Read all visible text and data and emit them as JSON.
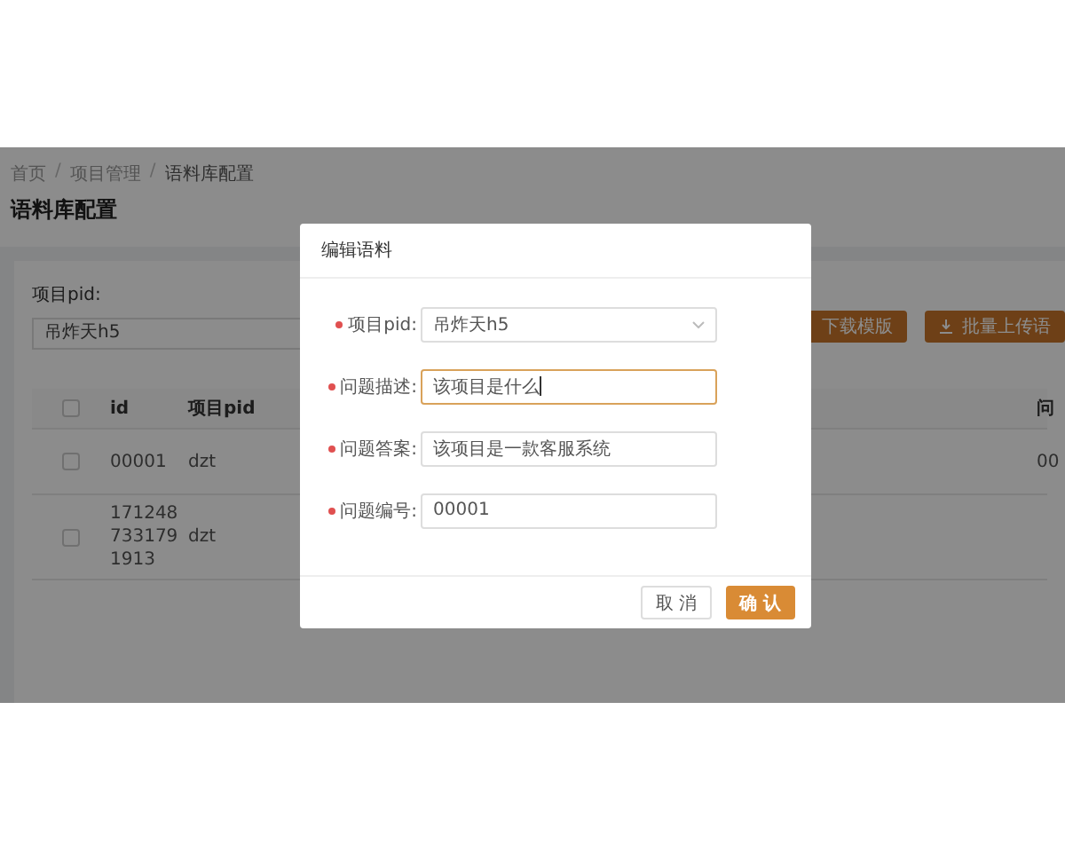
{
  "breadcrumb": {
    "separator": "/",
    "items": [
      "首页",
      "项目管理",
      "语料库配置"
    ]
  },
  "page_title": "语料库配置",
  "filter": {
    "label": "项目pid:",
    "value": "吊炸天h5"
  },
  "actions": [
    {
      "label": "下载模版"
    },
    {
      "label": "批量上传语",
      "icon": true
    }
  ],
  "table": {
    "header_checked": false,
    "columns": [
      "id",
      "项目pid",
      "问"
    ],
    "rows": [
      {
        "checked": false,
        "cells": [
          "00001",
          "dzt",
          "00"
        ]
      },
      {
        "checked": false,
        "cells": [
          "1712487331791913",
          "dzt"
        ]
      }
    ]
  },
  "dialog": {
    "title": "编辑语料",
    "fields": [
      {
        "label": "项目pid:",
        "required": true,
        "kind": "select",
        "value": "吊炸天h5",
        "focused": false
      },
      {
        "label": "问题描述:",
        "required": true,
        "kind": "input",
        "value": "该项目是什么",
        "focused": true
      },
      {
        "label": "问题答案:",
        "required": true,
        "kind": "input",
        "value": "该项目是一款客服系统",
        "focused": false
      },
      {
        "label": "问题编号:",
        "required": true,
        "kind": "input",
        "value": "00001",
        "focused": false
      }
    ],
    "buttons": [
      {
        "label": "取 消",
        "primary": false
      },
      {
        "label": "确 认",
        "primary": true
      }
    ]
  }
}
